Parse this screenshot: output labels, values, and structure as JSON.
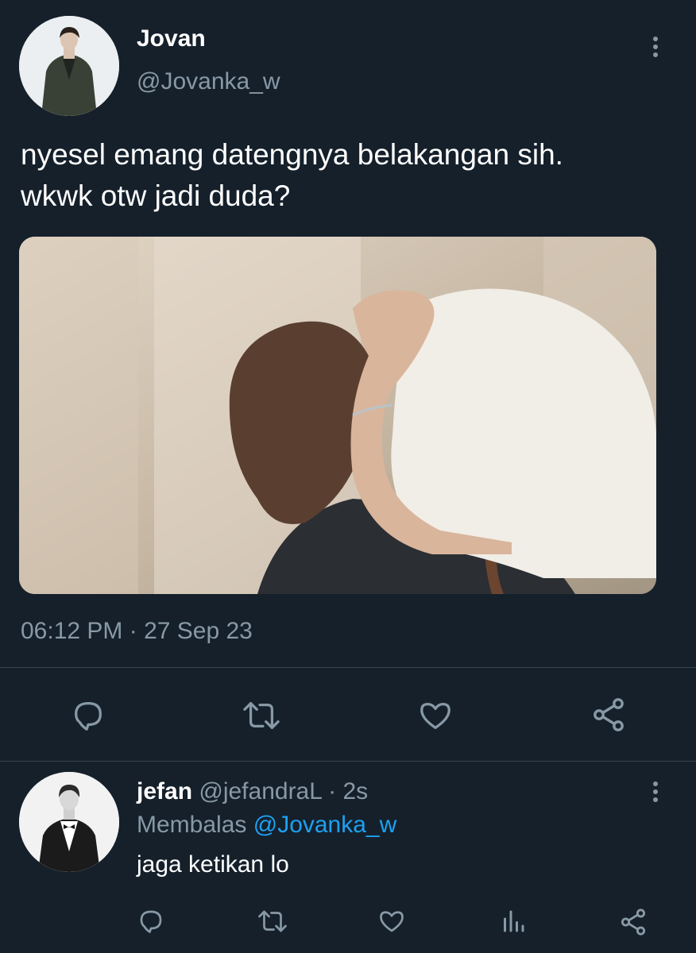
{
  "tweet": {
    "author_name": "Jovan",
    "author_handle": "@Jovanka_w",
    "text_line1": "nyesel emang datengnya belakangan sih.",
    "text_line2": "wkwk otw jadi duda?",
    "timestamp": "06:12 PM · 27 Sep 23",
    "actions": [
      "reply-icon",
      "retweet-icon",
      "like-icon",
      "share-icon"
    ]
  },
  "reply": {
    "author_name": "jefan",
    "author_handle": "@jefandraL",
    "time": "· 2s",
    "replying_prefix": "Membalas",
    "replying_to": "@Jovanka_w",
    "text": "jaga ketikan lo",
    "actions": [
      "reply-icon",
      "retweet-icon",
      "like-icon",
      "analytics-icon",
      "share-icon"
    ]
  },
  "colors": {
    "background": "#15202b",
    "muted": "#8899a6",
    "link": "#1da1f2",
    "divider": "#38444d"
  }
}
